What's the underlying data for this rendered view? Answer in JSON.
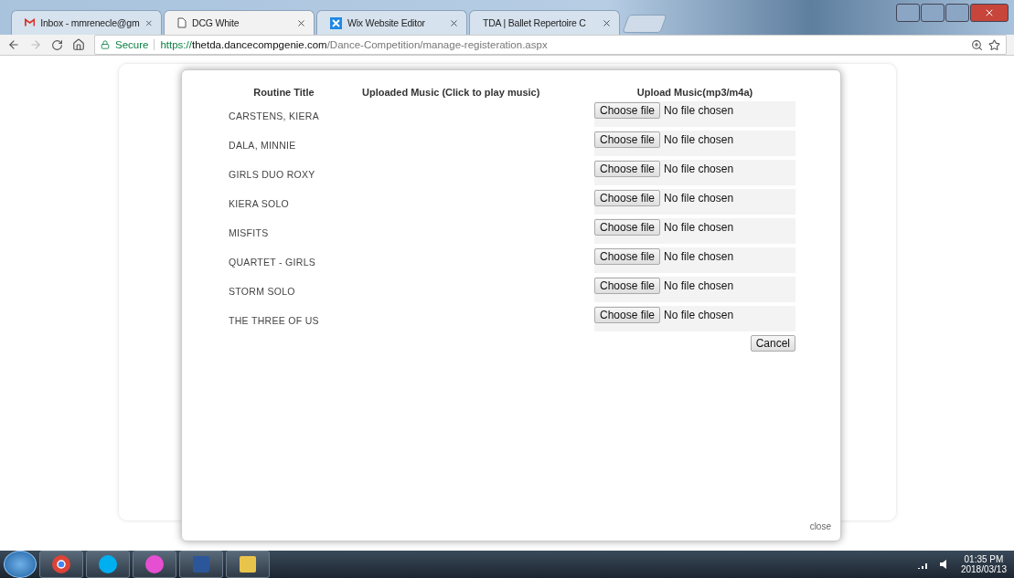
{
  "browser": {
    "tabs": [
      {
        "title": "Inbox - mmrenecle@gm",
        "selected": false
      },
      {
        "title": "DCG White",
        "selected": true
      },
      {
        "title": "Wix Website Editor",
        "selected": false
      },
      {
        "title": "TDA | Ballet Repertoire C",
        "selected": false
      }
    ],
    "secure_label": "Secure",
    "url": {
      "scheme": "https://",
      "host": "thetda.dancecompgenie.com",
      "path": "/Dance-Competition/manage-registeration.aspx"
    }
  },
  "dialog": {
    "columns": [
      "Routine Title",
      "Uploaded Music  (Click to play music)",
      "Upload Music(mp3/m4a)"
    ],
    "rows": [
      {
        "title": "CARSTENS, KIERA",
        "button": "Choose file",
        "status": "No file chosen"
      },
      {
        "title": "DALA, MINNIE",
        "button": "Choose file",
        "status": "No file chosen"
      },
      {
        "title": "GIRLS DUO ROXY",
        "button": "Choose file",
        "status": "No file chosen"
      },
      {
        "title": "KIERA SOLO",
        "button": "Choose file",
        "status": "No file chosen"
      },
      {
        "title": "MISFITS",
        "button": "Choose file",
        "status": "No file chosen"
      },
      {
        "title": "QUARTET - GIRLS",
        "button": "Choose file",
        "status": "No file chosen"
      },
      {
        "title": "STORM SOLO",
        "button": "Choose file",
        "status": "No file chosen"
      },
      {
        "title": "THE THREE OF US",
        "button": "Choose file",
        "status": "No file chosen"
      }
    ],
    "cancel": "Cancel",
    "close": "close"
  },
  "taskbar": {
    "time": "01:35 PM",
    "date": "2018/03/13"
  }
}
